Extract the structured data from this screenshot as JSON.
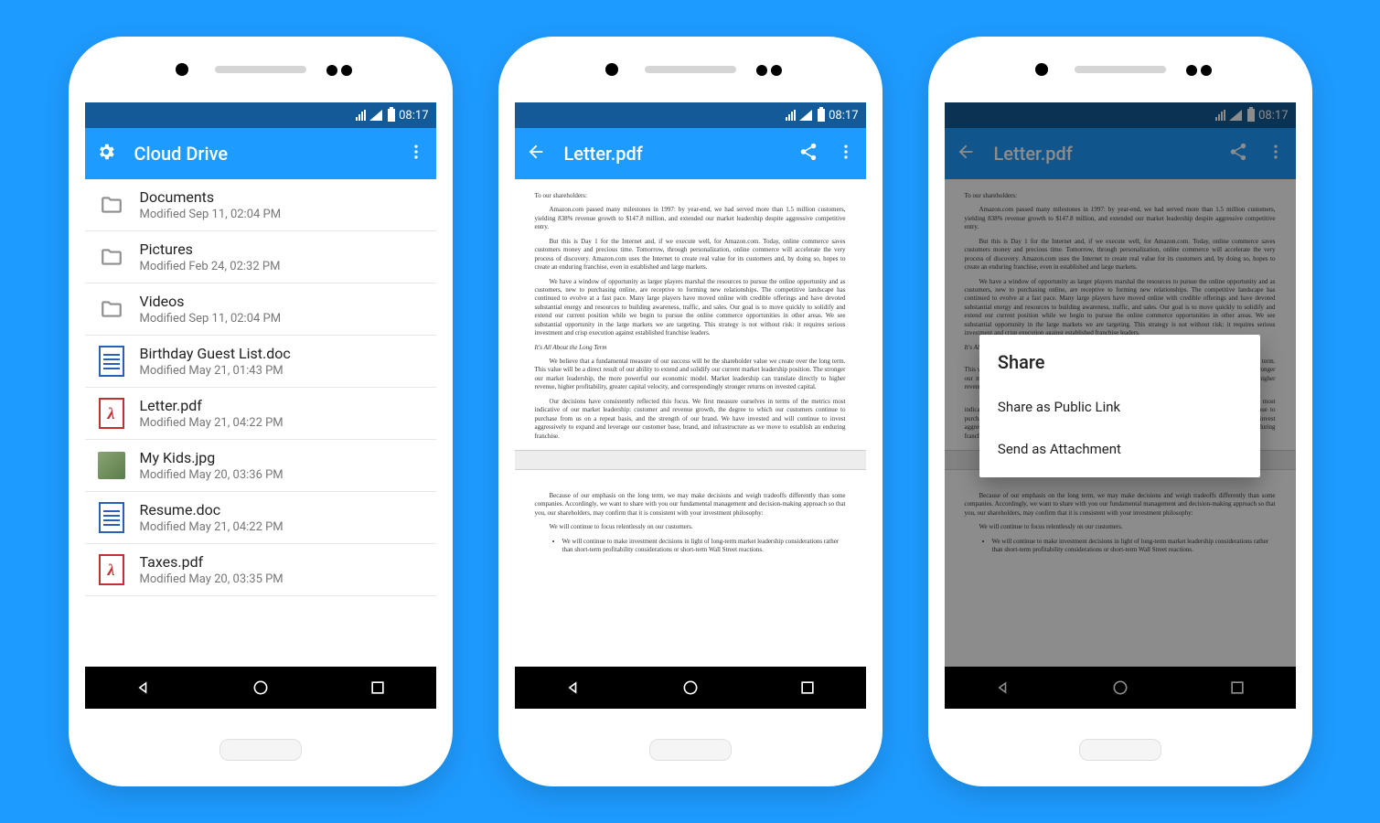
{
  "status": {
    "time": "08:17"
  },
  "screen1": {
    "title": "Cloud Drive",
    "files": [
      {
        "name": "Documents",
        "modified": "Modified Sep 11, 02:04 PM",
        "type": "folder"
      },
      {
        "name": "Pictures",
        "modified": "Modified Feb 24, 02:32 PM",
        "type": "folder"
      },
      {
        "name": "Videos",
        "modified": "Modified Sep 11, 02:04 PM",
        "type": "folder"
      },
      {
        "name": "Birthday Guest List.doc",
        "modified": "Modified May 21, 01:43 PM",
        "type": "doc"
      },
      {
        "name": "Letter.pdf",
        "modified": "Modified May 21, 04:22 PM",
        "type": "pdf"
      },
      {
        "name": "My Kids.jpg",
        "modified": "Modified May 20, 03:36 PM",
        "type": "img"
      },
      {
        "name": "Resume.doc",
        "modified": "Modified May 21, 04:22 PM",
        "type": "doc"
      },
      {
        "name": "Taxes.pdf",
        "modified": "Modified May 20, 03:35 PM",
        "type": "pdf"
      }
    ]
  },
  "screen2": {
    "title": "Letter.pdf"
  },
  "screen3": {
    "title": "Letter.pdf",
    "dialog_title": "Share",
    "option1": "Share as Public Link",
    "option2": "Send as Attachment"
  },
  "letter": {
    "greeting": "To our shareholders:",
    "p1": "Amazon.com passed many milestones in 1997: by year-end, we had served more than 1.5 million customers, yielding 838% revenue growth to $147.8 million, and extended our market leadership despite aggressive competitive entry.",
    "p2": "But this is Day 1 for the Internet and, if we execute well, for Amazon.com. Today, online commerce saves customers money and precious time. Tomorrow, through personalization, online commerce will accelerate the very process of discovery. Amazon.com uses the Internet to create real value for its customers and, by doing so, hopes to create an enduring franchise, even in established and large markets.",
    "p3": "We have a window of opportunity as larger players marshal the resources to pursue the online opportunity and as customers, new to purchasing online, are receptive to forming new relationships. The competitive landscape has continued to evolve at a fast pace. Many large players have moved online with credible offerings and have devoted substantial energy and resources to building awareness, traffic, and sales. Our goal is to move quickly to solidify and extend our current position while we begin to pursue the online commerce opportunities in other areas. We see substantial opportunity in the large markets we are targeting. This strategy is not without risk: it requires serious investment and crisp execution against established franchise leaders.",
    "sub1": "It's All About the Long Term",
    "p4": "We believe that a fundamental measure of our success will be the shareholder value we create over the long term. This value will be a direct result of our ability to extend and solidify our current market leadership position. The stronger our market leadership, the more powerful our economic model. Market leadership can translate directly to higher revenue, higher profitability, greater capital velocity, and correspondingly stronger returns on invested capital.",
    "p5": "Our decisions have consistently reflected this focus. We first measure ourselves in terms of the metrics most indicative of our market leadership: customer and revenue growth, the degree to which our customers continue to purchase from us on a repeat basis, and the strength of our brand. We have invested and will continue to invest aggressively to expand and leverage our customer base, brand, and infrastructure as we move to establish an enduring franchise.",
    "p6": "Because of our emphasis on the long term, we may make decisions and weigh tradeoffs differently than some companies. Accordingly, we want to share with you our fundamental management and decision-making approach so that you, our shareholders, may confirm that it is consistent with your investment philosophy:",
    "p7": "We will continue to focus relentlessly on our customers.",
    "bullet1": "We will continue to make investment decisions in light of long-term market leadership considerations rather than short-term profitability considerations or short-term Wall Street reactions."
  }
}
